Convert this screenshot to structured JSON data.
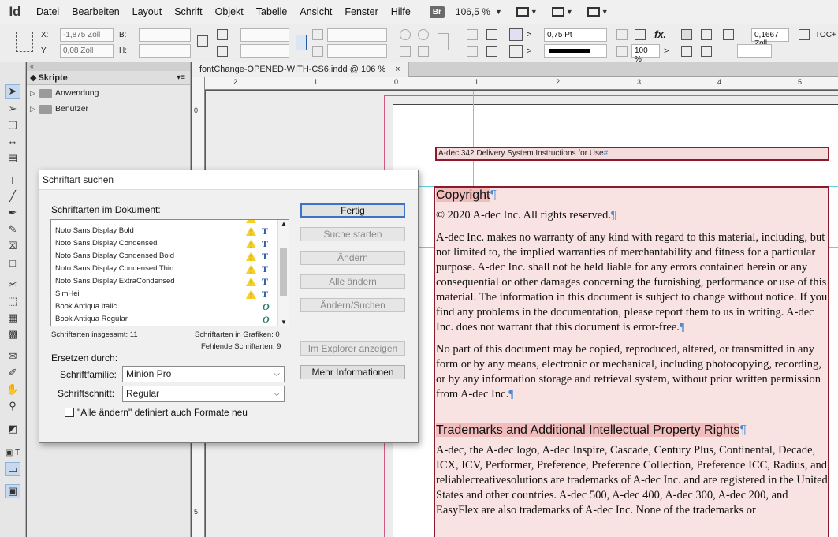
{
  "app": {
    "logo": "Id",
    "bridge_badge": "Br",
    "zoom": "106,5 %"
  },
  "menu": [
    "Datei",
    "Bearbeiten",
    "Layout",
    "Schrift",
    "Objekt",
    "Tabelle",
    "Ansicht",
    "Fenster",
    "Hilfe"
  ],
  "controlbar": {
    "x_label": "X:",
    "x_value": "-1,875 Zoll",
    "y_label": "Y:",
    "y_value": "0,08 Zoll",
    "b_label": "B:",
    "h_label": "H:",
    "stroke_weight": "0,75 Pt",
    "opacity": "100 %",
    "gap_value": "0,1667 Zoll",
    "toc_label": "TOC+"
  },
  "panel": {
    "title": "Skripte",
    "folders": [
      "Anwendung",
      "Benutzer"
    ]
  },
  "document": {
    "tab_title": "fontChange-OPENED-WITH-CS6.indd @ 106 %",
    "close_symbol": "×",
    "ruler_h": [
      "2",
      "1",
      "0",
      "1",
      "2",
      "3",
      "4",
      "5"
    ],
    "ruler_v": [
      "0",
      "5"
    ],
    "header_text": "A-dec 342 Delivery System Instructions for Use",
    "copyright_heading": "Copyright",
    "copyright_line": "© 2020 A-dec Inc. All rights reserved.",
    "para1": "A-dec Inc. makes no warranty of any kind with regard to this material, including, but not limited to, the implied warranties of merchantability and fitness for a particular purpose. A-dec Inc. shall not be held liable for any errors contained herein or any consequential or other damages concerning the furnishing, performance or use of this material. The information in this document is subject to change without notice. If you find any problems in the documentation, please report them to us in writing. A-dec Inc. does not warrant that this document is error-free.",
    "para2": "No part of this document may be copied, reproduced, altered, or transmitted in any form or by any means, electronic or mechanical, including photocopying, recording, or by any information storage and retrieval system, without prior written permission from A-dec Inc.",
    "trademarks_heading": "Trademarks and Additional Intellectual Property Rights",
    "para3": "A-dec, the A-dec logo, A-dec Inspire, Cascade, Century Plus, Continental, Decade, ICX, ICV, Performer, Preference, Preference Collection, Preference ICC, Radius, and reliablecreativesolutions are trademarks of A-dec Inc. and are registered in the United States and other countries. A-dec 500, A-dec 400, A-dec 300, A-dec 200, and EasyFlex are also trademarks of A-dec Inc. None of the trademarks or",
    "pilcrow": "¶"
  },
  "dialog": {
    "title": "Schriftart suchen",
    "fonts_label": "Schriftarten im Dokument:",
    "fonts": [
      {
        "name": "Noto Sans Display Bold",
        "kind": "T",
        "missing": true
      },
      {
        "name": "Noto Sans Display Condensed",
        "kind": "T",
        "missing": true
      },
      {
        "name": "Noto Sans Display Condensed Bold",
        "kind": "T",
        "missing": true
      },
      {
        "name": "Noto Sans Display Condensed Thin",
        "kind": "T",
        "missing": true
      },
      {
        "name": "Noto Sans Display ExtraCondensed",
        "kind": "T",
        "missing": true
      },
      {
        "name": "SimHei",
        "kind": "T",
        "missing": true
      },
      {
        "name": "Book Antiqua Italic",
        "kind": "O",
        "missing": false
      },
      {
        "name": "Book Antiqua Regular",
        "kind": "O",
        "missing": false
      }
    ],
    "total_fonts": "Schriftarten insgesamt: 11",
    "fonts_in_graphics": "Schriftarten in Grafiken: 0",
    "missing_fonts": "Fehlende Schriftarten: 9",
    "replace_with": "Ersetzen durch:",
    "family_label": "Schriftfamilie:",
    "family_value": "Minion Pro",
    "style_label": "Schriftschnitt:",
    "style_value": "Regular",
    "checkbox_label": "\"Alle ändern\" definiert auch Formate neu",
    "buttons": {
      "done": "Fertig",
      "find_first": "Suche starten",
      "change": "Ändern",
      "change_all": "Alle ändern",
      "change_find": "Ändern/Suchen",
      "reveal": "Im Explorer anzeigen",
      "more_info": "Mehr Informationen"
    }
  }
}
